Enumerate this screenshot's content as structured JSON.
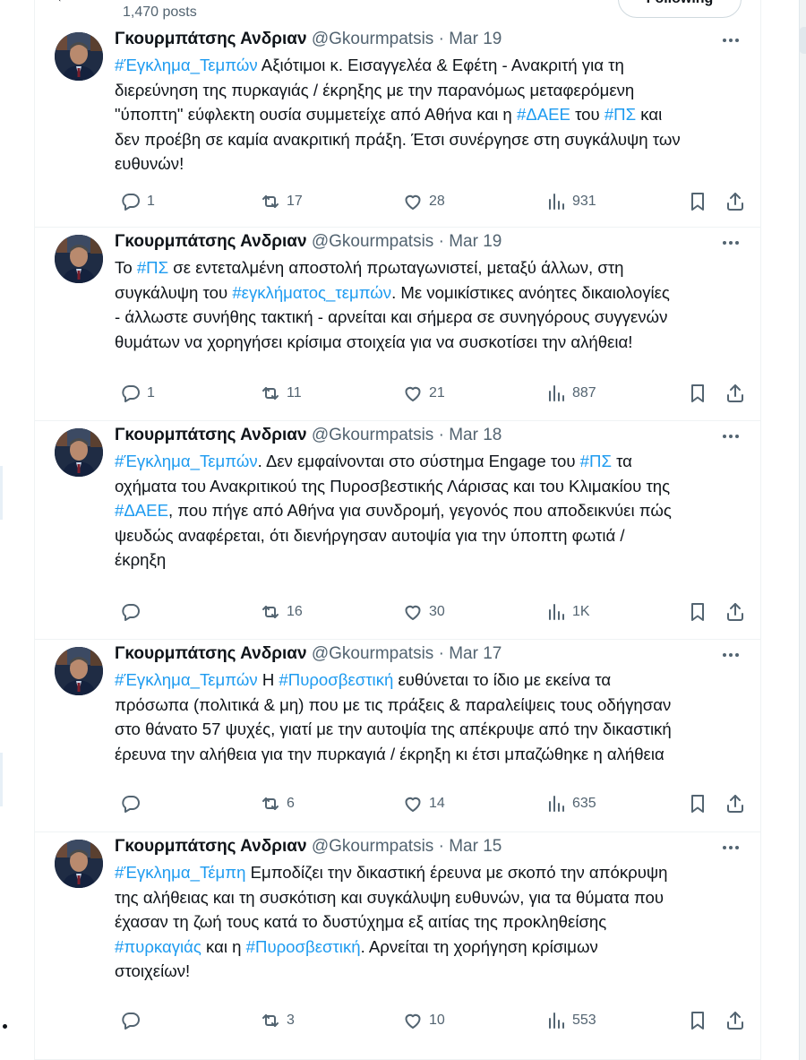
{
  "header": {
    "post_count": "1,470 posts",
    "following_label": "Following",
    "back_icon": "arrow-left-icon"
  },
  "author": {
    "name": "Γκουρμπάτσης Ανδριαν",
    "handle": "@Gkourmpatsis"
  },
  "tweets": [
    {
      "date": "· Mar 19",
      "lines": [
        [
          {
            "t": "#Έγκλημα_Τεμπών",
            "tag": true
          },
          {
            "t": " Αξιότιμοι κ. Εισαγγελέα & Εφέτη - Ανακριτή για τη"
          }
        ],
        [
          {
            "t": "διερεύνηση της πυρκαγιάς / έκρηξης με την παρανόμως μεταφερόμενη"
          }
        ],
        [
          {
            "t": "\"ύποπτη\" εύφλεκτη ουσία συμμετείχε από Αθήνα και η "
          },
          {
            "t": "#ΔΑΕΕ",
            "tag": true
          },
          {
            "t": " του "
          },
          {
            "t": "#ΠΣ",
            "tag": true
          },
          {
            "t": " και"
          }
        ],
        [
          {
            "t": "δεν προέβη σε καμία ανακριτική πράξη. Έτσι συνέργησε στη συγκάλυψη των"
          }
        ],
        [
          {
            "t": "ευθυνών!"
          }
        ]
      ],
      "replies": "1",
      "reposts": "17",
      "likes": "28",
      "views": "931"
    },
    {
      "date": "· Mar 19",
      "lines": [
        [
          {
            "t": "Το "
          },
          {
            "t": "#ΠΣ",
            "tag": true
          },
          {
            "t": " σε εντεταλμένη αποστολή πρωταγωνιστεί, μεταξύ άλλων, στη"
          }
        ],
        [
          {
            "t": "συγκάλυψη του "
          },
          {
            "t": "#εγκλήματος_τεμπών",
            "tag": true
          },
          {
            "t": ". Με νομικίστικες ανόητες δικαιολογίες"
          }
        ],
        [
          {
            "t": "- άλλωστε συνήθης τακτική - αρνείται και σήμερα σε συνηγόρους συγγενών"
          }
        ],
        [
          {
            "t": "θυμάτων να χορηγήσει κρίσιμα στοιχεία για να συσκοτίσει την αλήθεια!"
          }
        ]
      ],
      "replies": "1",
      "reposts": "11",
      "likes": "21",
      "views": "887"
    },
    {
      "date": "· Mar 18",
      "lines": [
        [
          {
            "t": "#Έγκλημα_Τεμπών",
            "tag": true
          },
          {
            "t": ". Δεν εμφαίνονται στο σύστημα Engage του "
          },
          {
            "t": "#ΠΣ",
            "tag": true
          },
          {
            "t": " τα"
          }
        ],
        [
          {
            "t": "οχήματα του Ανακριτικού της Πυροσβεστικής Λάρισας και του Κλιμακίου της"
          }
        ],
        [
          {
            "t": "#ΔΑΕΕ",
            "tag": true
          },
          {
            "t": ", που πήγε από Αθήνα για συνδρομή, γεγονός που αποδεικνύει πώς"
          }
        ],
        [
          {
            "t": "ψευδώς αναφέρεται, ότι διενήργησαν αυτοψία για την ύποπτη φωτιά /"
          }
        ],
        [
          {
            "t": "έκρηξη"
          }
        ]
      ],
      "replies": "",
      "reposts": "16",
      "likes": "30",
      "views": "1K"
    },
    {
      "date": "· Mar 17",
      "lines": [
        [
          {
            "t": "#Έγκλημα_Τεμπών",
            "tag": true
          },
          {
            "t": " Η "
          },
          {
            "t": "#Πυροσβεστική",
            "tag": true
          },
          {
            "t": " ευθύνεται το ίδιο με εκείνα τα"
          }
        ],
        [
          {
            "t": "πρόσωπα (πολιτικά & μη) που με τις πράξεις & παραλείψεις τους οδήγησαν"
          }
        ],
        [
          {
            "t": "στο θάνατο 57 ψυχές, γιατί με την αυτοψία της απέκρυψε από την δικαστική"
          }
        ],
        [
          {
            "t": "έρευνα την αλήθεια για την πυρκαγιά / έκρηξη κι έτσι μπαζώθηκε η αλήθεια"
          }
        ]
      ],
      "replies": "",
      "reposts": "6",
      "likes": "14",
      "views": "635"
    },
    {
      "date": "· Mar 15",
      "lines": [
        [
          {
            "t": "#Έγκλημα_Τέμπη",
            "tag": true
          },
          {
            "t": " Εμποδίζει την δικαστική έρευνα με σκοπό την απόκρυψη"
          }
        ],
        [
          {
            "t": "της αλήθειας και τη συσκότιση και συγκάλυψη ευθυνών, για τα θύματα που"
          }
        ],
        [
          {
            "t": "έχασαν τη ζωή τους κατά το δυστύχημα εξ αιτίας της προκληθείσης"
          }
        ],
        [
          {
            "t": "#πυρκαγιάς",
            "tag": true
          },
          {
            "t": " και η "
          },
          {
            "t": "#Πυροσβεστική",
            "tag": true
          },
          {
            "t": ". Αρνείται τη χορήγηση κρίσιμων"
          }
        ],
        [
          {
            "t": "στοιχείων!"
          }
        ]
      ],
      "replies": "",
      "reposts": "3",
      "likes": "10",
      "views": "553"
    }
  ],
  "icons": {
    "more": "more-horizontal-icon",
    "reply": "reply-icon",
    "repost": "repost-icon",
    "like": "heart-icon",
    "views": "views-chart-icon",
    "bookmark": "bookmark-icon",
    "share": "share-icon"
  },
  "colors": {
    "link": "#1d9bf0",
    "text": "#0f1419",
    "muted": "#536471",
    "divider": "#eff3f4"
  }
}
